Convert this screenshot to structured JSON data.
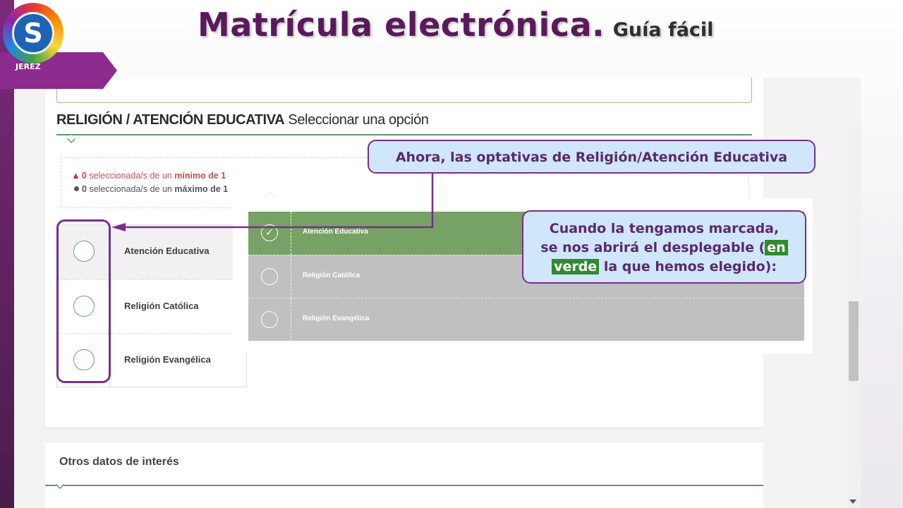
{
  "slide": {
    "title_main": "Matrícula electrónica.",
    "title_sub": "Guía fácil",
    "logo_initial": "S",
    "logo_text": "JEREZ"
  },
  "section": {
    "title_bold": "RELIGIÓN / ATENCIÓN EDUCATIVA",
    "title_rest": "Seleccionar una opción",
    "counter_min": {
      "count": "0",
      "text": "seleccionada/s de un",
      "limit": "mínimo de 1"
    },
    "counter_max": {
      "count": "0",
      "text": "seleccionada/s de un",
      "limit": "máximo de 1"
    }
  },
  "options": [
    {
      "label": "Atención Educativa"
    },
    {
      "label": "Religión Católica"
    },
    {
      "label": "Religión Evangélica"
    }
  ],
  "dropdown": [
    {
      "label": "Atención Educativa",
      "selected": true
    },
    {
      "label": "Religión Católica",
      "selected": false
    },
    {
      "label": "Religión Evangélica",
      "selected": false
    }
  ],
  "other_section": {
    "title": "Otros datos de interés"
  },
  "callouts": {
    "first": "Ahora, las optativas de Religión/Atención Educativa",
    "second_line1": "Cuando la tengamos marcada,",
    "second_line2a": "se nos abrirá el desplegable (",
    "second_hl1": "en",
    "second_hl2": "verde",
    "second_line3": "la que hemos elegido):"
  },
  "colors": {
    "accent_green": "#77a265",
    "unselected_gray": "#c0c0c0",
    "callout_bg": "#cfe6fb",
    "callout_border": "#7a2d8e",
    "title_purple": "#5a1a5a"
  },
  "icons": {
    "warning": "warning-icon",
    "bullet": "dot-icon",
    "check": "check-icon",
    "radio": "radio-icon"
  }
}
